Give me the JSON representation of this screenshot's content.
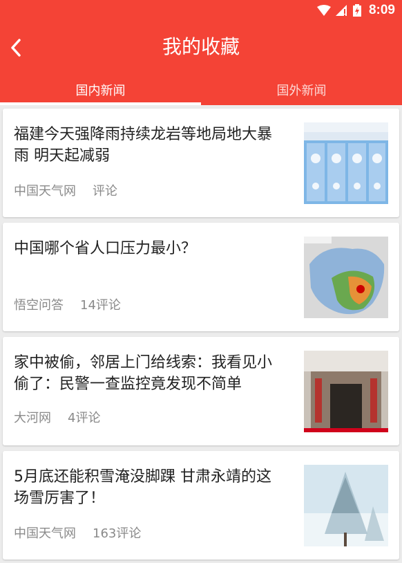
{
  "status_bar": {
    "time": "8:09",
    "icons": [
      "wifi-icon",
      "signal-icon",
      "battery-icon"
    ]
  },
  "header": {
    "title": "我的收藏",
    "back_icon": "chevron-left-icon"
  },
  "tabs": [
    {
      "label": "国内新闻",
      "active": true
    },
    {
      "label": "国外新闻",
      "active": false
    }
  ],
  "articles": [
    {
      "title": "福建今天强降雨持续龙岩等地局地大暴雨 明天起减弱",
      "source": "中国天气网",
      "comments": "评论",
      "thumbnail": "weather-forecast-image"
    },
    {
      "title": "中国哪个省人口压力最小？",
      "source": "悟空问答",
      "comments": "14评论",
      "thumbnail": "china-population-map-image"
    },
    {
      "title": "家中被偷，邻居上门给线索：我看见小偷了：民警一查监控竟发现不简单",
      "source": "大河网",
      "comments": "4评论",
      "thumbnail": "house-doorway-image"
    },
    {
      "title": "5月底还能积雪淹没脚踝 甘肃永靖的这场雪厉害了！",
      "source": "中国天气网",
      "comments": "163评论",
      "thumbnail": "snowy-tree-image"
    }
  ],
  "colors": {
    "accent": "#f44336",
    "card_bg": "#ffffff",
    "page_bg": "#ececec",
    "meta_text": "#8a8a8a"
  }
}
